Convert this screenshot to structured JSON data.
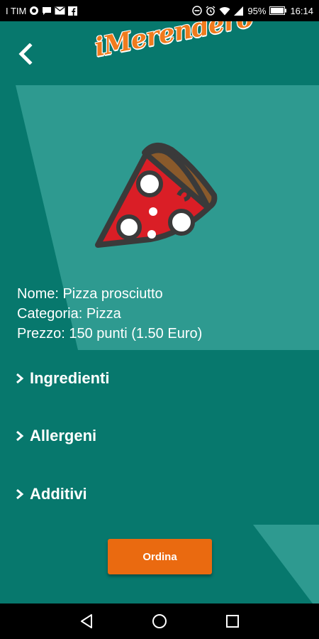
{
  "status_bar": {
    "carrier": "I TIM",
    "battery": "95%",
    "time": "16:14",
    "icons_left": [
      "whatsapp-icon",
      "chat-bubble-icon",
      "mail-icon",
      "facebook-icon"
    ],
    "icons_right": [
      "do-not-disturb-icon",
      "alarm-icon",
      "wifi-icon",
      "signal-icon",
      "battery-icon"
    ]
  },
  "header": {
    "logo_text": "iMerendero",
    "back_icon": "chevron-left-icon"
  },
  "colors": {
    "background": "#07786D",
    "light_panel": "#2E9A90",
    "accent": "#EA6A10",
    "logo": "#F07B1D"
  },
  "product": {
    "image": "pizza-slice-icon",
    "name_line": "Nome: Pizza prosciutto",
    "category_line": "Categoria: Pizza",
    "price_line": "Prezzo: 150 punti (1.50 Euro)"
  },
  "sections": [
    {
      "label": "Ingredienti"
    },
    {
      "label": "Allergeni"
    },
    {
      "label": "Additivi"
    }
  ],
  "order_button": {
    "label": "Ordina"
  },
  "nav_bar": {
    "icons": [
      "back-triangle-icon",
      "home-circle-icon",
      "recents-square-icon"
    ]
  }
}
